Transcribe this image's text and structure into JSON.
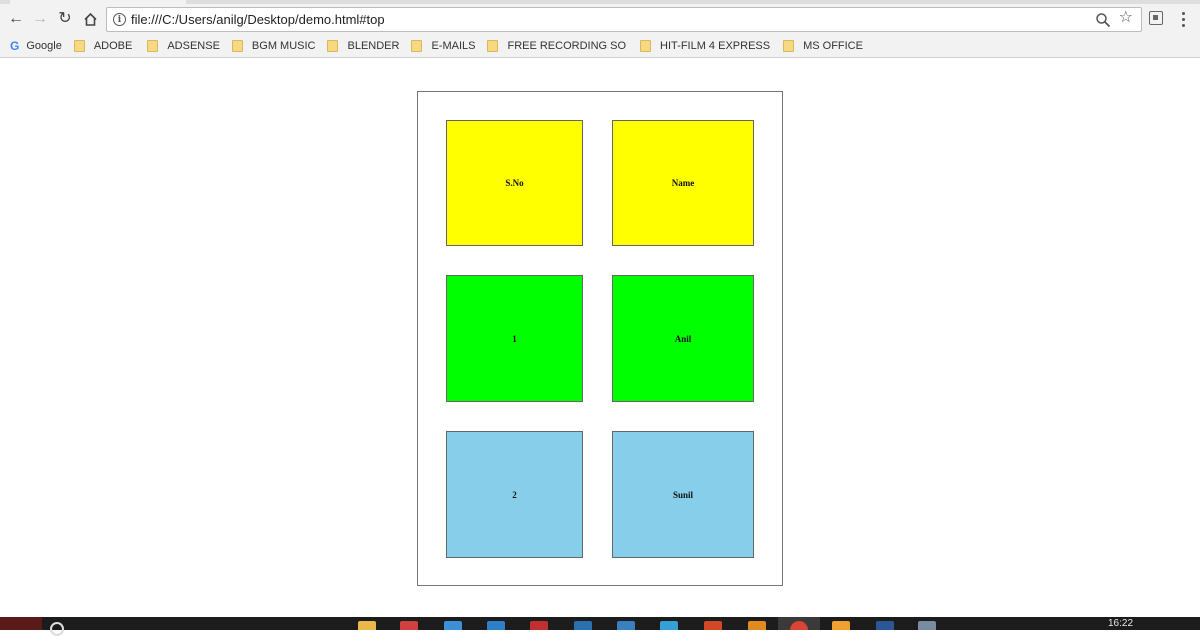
{
  "browser": {
    "url": "file:///C:/Users/anilg/Desktop/demo.html#top",
    "bookmarks": [
      {
        "label": "Google",
        "icon": "google-icon"
      },
      {
        "label": "ADOBE",
        "icon": "folder-icon"
      },
      {
        "label": "ADSENSE",
        "icon": "folder-icon"
      },
      {
        "label": "BGM MUSIC",
        "icon": "folder-icon"
      },
      {
        "label": "BLENDER",
        "icon": "folder-icon"
      },
      {
        "label": "E-MAILS",
        "icon": "folder-icon"
      },
      {
        "label": "FREE RECORDING SO",
        "icon": "folder-icon"
      },
      {
        "label": "HIT-FILM 4 EXPRESS",
        "icon": "folder-icon"
      },
      {
        "label": "MS OFFICE",
        "icon": "folder-icon"
      }
    ]
  },
  "table": {
    "header": {
      "sno": "S.No",
      "name": "Name",
      "color": "#ffff00"
    },
    "rows": [
      {
        "sno": "1",
        "name": "Anil",
        "color": "#00ff00"
      },
      {
        "sno": "2",
        "name": "Sunil",
        "color": "#87ceeb"
      }
    ]
  },
  "taskbar": {
    "clock": "16:22"
  }
}
